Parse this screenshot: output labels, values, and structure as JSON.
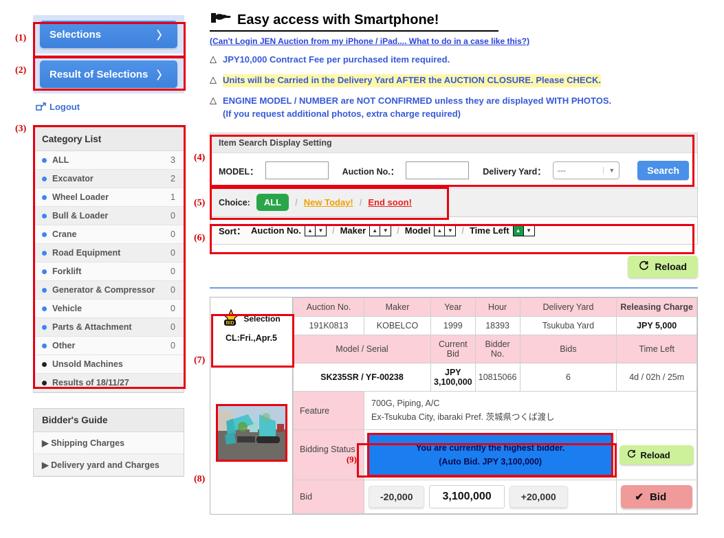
{
  "annotations": [
    "(1)",
    "(2)",
    "(3)",
    "(4)",
    "(5)",
    "(6)",
    "(7)",
    "(8)",
    "(9)"
  ],
  "sidebar": {
    "selections_button": "Selections",
    "result_button": "Result of Selections",
    "chevron": "〉",
    "logout": "Logout",
    "category_panel_title": "Category List",
    "categories": [
      {
        "label": "ALL",
        "count": "3"
      },
      {
        "label": "Excavator",
        "count": "2"
      },
      {
        "label": "Wheel Loader",
        "count": "1"
      },
      {
        "label": "Bull & Loader",
        "count": "0"
      },
      {
        "label": "Crane",
        "count": "0"
      },
      {
        "label": "Road Equipment",
        "count": "0"
      },
      {
        "label": "Forklift",
        "count": "0"
      },
      {
        "label": "Generator & Compressor",
        "count": "0"
      },
      {
        "label": "Vehicle",
        "count": "0"
      },
      {
        "label": "Parts & Attachment",
        "count": "0"
      },
      {
        "label": "Other",
        "count": "0"
      }
    ],
    "extra_links": [
      {
        "label": "Unsold Machines"
      },
      {
        "label": "Results of 18/11/27"
      }
    ],
    "guide_panel_title": "Bidder's Guide",
    "guide_items": [
      "Shipping Charges",
      "Delivery yard and Charges"
    ]
  },
  "header": {
    "title": "Easy access with Smartphone!",
    "link": "(Can't Login JEN Auction from my iPhone / iPad.... What to do in a case like this?)",
    "notices": [
      {
        "marker": "△",
        "text": "JPY10,000 Contract Fee per purchased item required.",
        "highlight": false
      },
      {
        "marker": "△",
        "text": "Units will be Carried in the Delivery Yard AFTER the AUCTION CLOSURE. Please CHECK.",
        "highlight": true
      },
      {
        "marker": "△",
        "text": "ENGINE MODEL / NUMBER are NOT CONFIRMED unless they are displayed WITH PHOTOS.",
        "highlight": false
      },
      {
        "marker": "",
        "text": "(If you request additional photos, extra charge required)",
        "highlight": false
      }
    ]
  },
  "search": {
    "panel_title": "Item Search Display Setting",
    "model_label": "MODEL：",
    "model_value": "",
    "auction_no_label": "Auction No.：",
    "auction_no_value": "",
    "delivery_yard_label": "Delivery Yard：",
    "delivery_yard_value": "---",
    "dropdown_caret": "▼",
    "search_button": "Search"
  },
  "choice": {
    "label": "Choice:",
    "all": "ALL",
    "sep": "/",
    "new_today": "New Today!",
    "end_soon": "End soon!"
  },
  "sort": {
    "label": "Sort：",
    "sep": "/",
    "up": "▲",
    "down": "▼",
    "items": [
      {
        "label": "Auction No.",
        "active": ""
      },
      {
        "label": "Maker",
        "active": ""
      },
      {
        "label": "Model",
        "active": ""
      },
      {
        "label": "Time Left",
        "active": "up"
      }
    ]
  },
  "reload_top": {
    "label": "Reload",
    "icon": "↻"
  },
  "listing": {
    "selection_label": "Selection",
    "bid_badge": "BID",
    "closing": "CL:Fri.,Apr.5",
    "headers_row1": [
      "Auction No.",
      "Maker",
      "Year",
      "Hour",
      "Delivery Yard",
      "Releasing Charge"
    ],
    "values_row1": [
      "191K0813",
      "KOBELCO",
      "1999",
      "18393",
      "Tsukuba Yard",
      "JPY 5,000"
    ],
    "headers_row2": [
      "Model / Serial",
      "Current Bid",
      "Bidder No.",
      "Bids",
      "Time Left"
    ],
    "values_row2": [
      "SK235SR / YF-00238",
      "JPY 3,100,000",
      "10815066",
      "6",
      "4d / 02h / 25m"
    ],
    "feature_label": "Feature",
    "feature_lines": [
      "700G, Piping, A/C",
      "Ex-Tsukuba City, ibaraki Pref. 茨城県つくば渡し"
    ],
    "bidding_status_label": "Bidding Status",
    "status_line1": "You are currently the highest bidder.",
    "status_line2": "(Auto Bid. JPY 3,100,000)",
    "status_reload": "Reload",
    "bid_label": "Bid",
    "decrement": "-20,000",
    "bid_value": "3,100,000",
    "increment": "+20,000",
    "bid_button": "Bid",
    "bid_check": "✔"
  },
  "colors": {
    "accent_blue": "#4a90e8",
    "green_chip": "#2aa64a",
    "reload_green": "#cdf09a",
    "bid_pink": "#f09a9a",
    "header_pink": "#fbd0d8",
    "status_blue": "#1a7ef0",
    "annotation_red": "#e60012",
    "highlight_yellow": "#fff7a8"
  }
}
